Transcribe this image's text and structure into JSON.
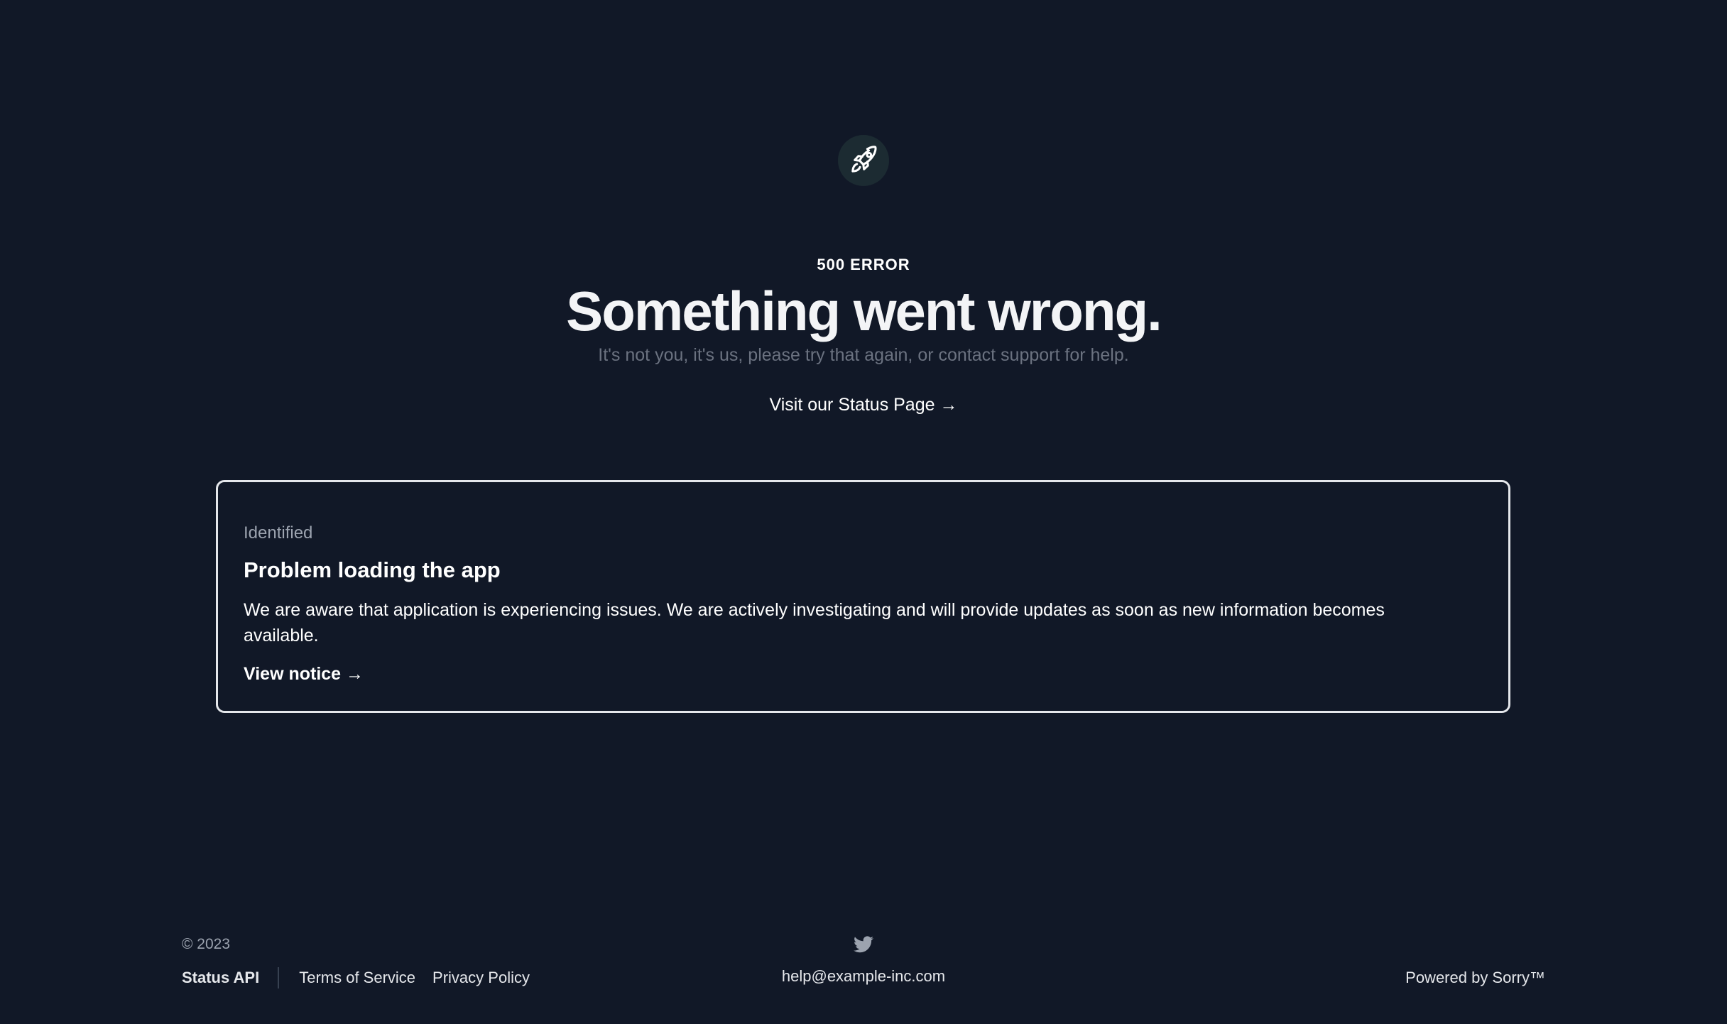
{
  "logo": {
    "icon": "rocket-icon",
    "background": "#1c2b32"
  },
  "hero": {
    "error_code": "500 ERROR",
    "title": "Something went wrong.",
    "subtitle": "It's not you, it's us, please try that again, or contact support for help.",
    "status_link": "Visit our Status Page →"
  },
  "notice": {
    "status": "Identified",
    "title": "Problem loading the app",
    "body": "We are aware that application is experiencing issues. We are actively investigating and will provide updates as soon as new information becomes available.",
    "link": "View notice →"
  },
  "footer": {
    "copyright": "© 2023",
    "links": {
      "status_api": "Status API",
      "terms": "Terms of Service",
      "privacy": "Privacy Policy"
    },
    "social_icon": "twitter-icon",
    "email": "help@example-inc.com",
    "powered_by": "Powered by Sorry™"
  },
  "colors": {
    "background": "#111827",
    "muted_text": "#6b7280",
    "card_border": "#e5e7eb"
  }
}
